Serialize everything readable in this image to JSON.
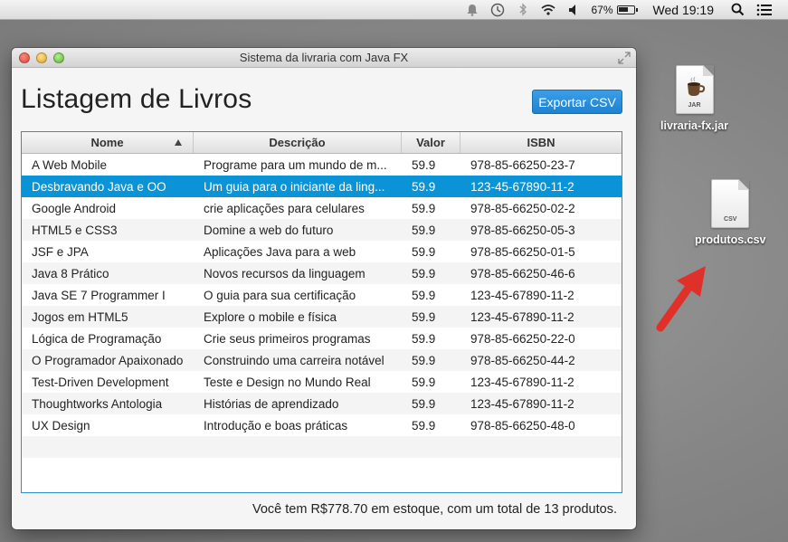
{
  "menubar": {
    "battery_percent": "67%",
    "battery_level": 0.67,
    "clock": "Wed 19:19",
    "icons": [
      "notification-icon",
      "time-machine-icon",
      "bluetooth-icon",
      "wifi-icon",
      "volume-icon",
      "battery-icon",
      "spotlight-search-icon",
      "notification-center-icon"
    ]
  },
  "window": {
    "title": "Sistema da livraria com Java FX",
    "heading": "Listagem de Livros",
    "export_button": "Exportar CSV",
    "accent_color": "#0a93d6",
    "table": {
      "columns": [
        "Nome",
        "Descrição",
        "Valor",
        "ISBN"
      ],
      "sorted_column": "Nome",
      "sort_direction": "ascending",
      "rows": [
        {
          "nome": "A Web Mobile",
          "descricao": "Programe para um mundo de m...",
          "valor": "59.9",
          "isbn": "978-85-66250-23-7"
        },
        {
          "nome": "Desbravando Java e OO",
          "descricao": "Um guia para o iniciante da ling...",
          "valor": "59.9",
          "isbn": "123-45-67890-11-2"
        },
        {
          "nome": "Google Android",
          "descricao": "crie aplicações para celulares",
          "valor": "59.9",
          "isbn": "978-85-66250-02-2"
        },
        {
          "nome": "HTML5 e CSS3",
          "descricao": "Domine a web do futuro",
          "valor": "59.9",
          "isbn": "978-85-66250-05-3"
        },
        {
          "nome": "JSF e JPA",
          "descricao": "Aplicações Java para a web",
          "valor": "59.9",
          "isbn": "978-85-66250-01-5"
        },
        {
          "nome": "Java 8 Prático",
          "descricao": "Novos recursos da linguagem",
          "valor": "59.9",
          "isbn": "978-85-66250-46-6"
        },
        {
          "nome": "Java SE 7 Programmer I",
          "descricao": "O guia para sua certificação",
          "valor": "59.9",
          "isbn": "123-45-67890-11-2"
        },
        {
          "nome": "Jogos em HTML5",
          "descricao": "Explore o mobile e física",
          "valor": "59.9",
          "isbn": "123-45-67890-11-2"
        },
        {
          "nome": "Lógica de Programação",
          "descricao": "Crie seus primeiros programas",
          "valor": "59.9",
          "isbn": "978-85-66250-22-0"
        },
        {
          "nome": "O Programador Apaixonado",
          "descricao": "Construindo uma carreira notável",
          "valor": "59.9",
          "isbn": "978-85-66250-44-2"
        },
        {
          "nome": "Test-Driven Development",
          "descricao": "Teste e Design no Mundo Real",
          "valor": "59.9",
          "isbn": "123-45-67890-11-2"
        },
        {
          "nome": "Thoughtworks Antologia",
          "descricao": "Histórias de aprendizado",
          "valor": "59.9",
          "isbn": "123-45-67890-11-2"
        },
        {
          "nome": "UX Design",
          "descricao": "Introdução e boas práticas",
          "valor": "59.9",
          "isbn": "978-85-66250-48-0"
        }
      ],
      "selected_row_index": 1
    },
    "footer": "Você tem R$778.70 em estoque, com um total de 13 produtos."
  },
  "desktop": {
    "icons": [
      {
        "label": "livraria-fx.jar",
        "ext": "JAR"
      },
      {
        "label": "produtos.csv",
        "ext": "CSV"
      }
    ],
    "arrow_color": "#e0302a"
  }
}
